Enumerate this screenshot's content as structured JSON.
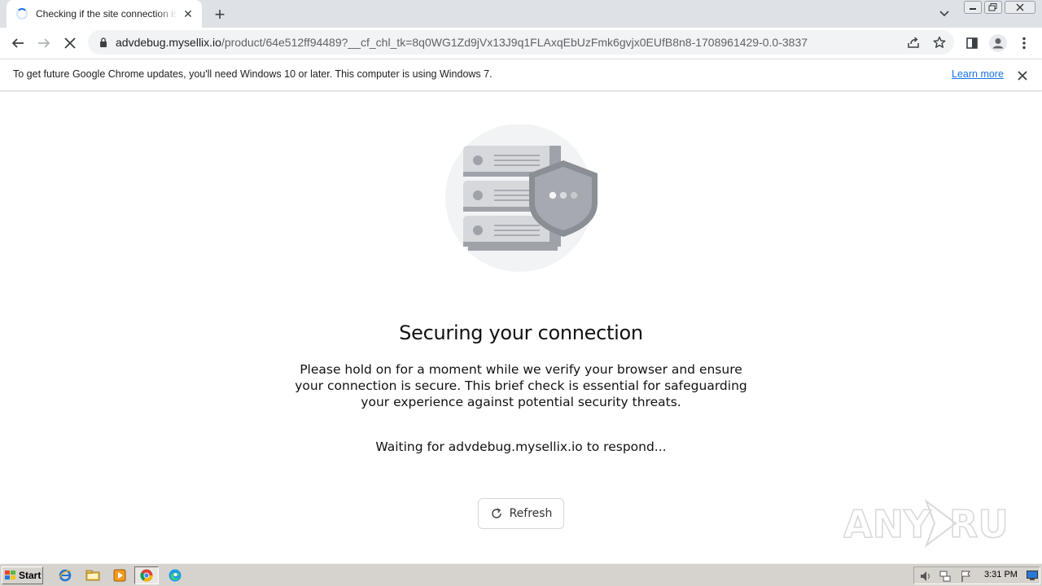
{
  "browser": {
    "tab_title": "Checking if the site connection is secure",
    "url_host": "advdebug.mysellix.io",
    "url_path": "/product/64e512ff94489?__cf_chl_tk=8q0WG1Zd9jVx13J9q1FLAxqEbUzFmk6gvjx0EUfB8n8-1708961429-0.0-3837"
  },
  "infobar": {
    "message": "To get future Google Chrome updates, you'll need Windows 10 or later. This computer is using Windows 7.",
    "link_label": "Learn more"
  },
  "page": {
    "heading": "Securing your connection",
    "description": "Please hold on for a moment while we verify your browser and ensure your connection is secure. This brief check is essential for safeguarding your experience against potential security threats.",
    "waiting_text": "Waiting for advdebug.mysellix.io to respond...",
    "refresh_label": "Refresh"
  },
  "watermark": {
    "text": "ANY RUN"
  },
  "taskbar": {
    "start_label": "Start",
    "clock": "3:31 PM"
  },
  "colors": {
    "accent": "#1a73e8",
    "illustration_gray": "#9ca0a6",
    "illustration_bg": "#f2f3f5"
  }
}
